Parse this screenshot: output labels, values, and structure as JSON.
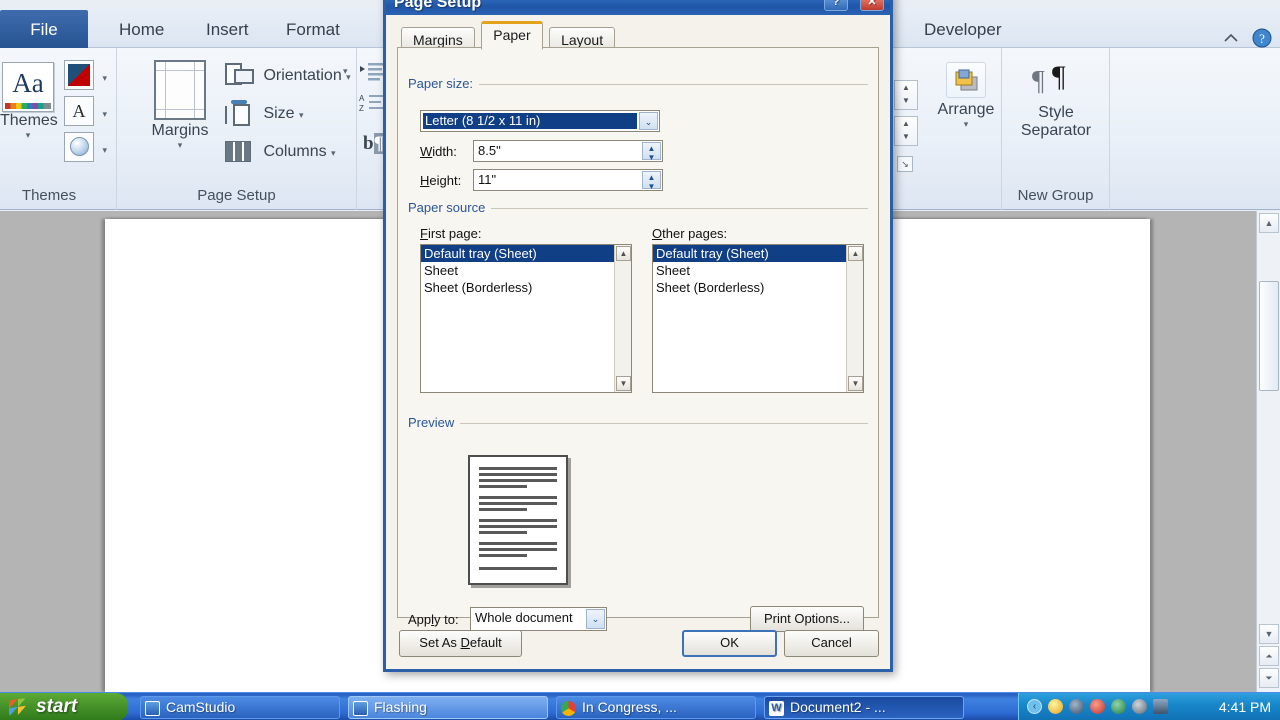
{
  "word": {
    "tabs": [
      {
        "label": "File",
        "kind": "file"
      },
      {
        "label": "Home",
        "kind": "normal"
      },
      {
        "label": "Insert",
        "kind": "normal"
      },
      {
        "label": "Format",
        "kind": "normal"
      },
      {
        "label": "Developer",
        "kind": "normal"
      }
    ],
    "groups": {
      "themes": {
        "name": "Themes",
        "big_button": "Themes",
        "aa_glyph": "Aa",
        "font_glyph": "A"
      },
      "page_setup": {
        "name": "Page Setup",
        "margins": "Margins",
        "orientation": "Orientation",
        "size": "Size",
        "columns": "Columns"
      },
      "arrange": {
        "name": "",
        "label": "Arrange"
      },
      "new_group": {
        "name": "New Group",
        "style_separator_line1": "Style",
        "style_separator_line2": "Separator"
      }
    },
    "caret": "▾",
    "help_icon": "help-icon",
    "collapse_icon": "collapse-ribbon-icon"
  },
  "dialog": {
    "title": "Page Setup",
    "help_button": "?",
    "close_button": "✕",
    "tabs": [
      {
        "label": "Margins",
        "active": false
      },
      {
        "label": "Paper",
        "active": true
      },
      {
        "label": "Layout",
        "active": false
      }
    ],
    "paper_size": {
      "section_title": "Paper size:",
      "selected": "Letter (8 1/2 x 11 in)",
      "width_label": "Width:",
      "width_value": "8.5\"",
      "height_label": "Height:",
      "height_value": "11\""
    },
    "paper_source": {
      "section_title": "Paper source",
      "first_page_label": "First page:",
      "other_pages_label": "Other pages:",
      "first_page_items": [
        "Default tray (Sheet)",
        "Sheet",
        "Sheet (Borderless)"
      ],
      "first_page_selected_index": 0,
      "other_pages_items": [
        "Default tray (Sheet)",
        "Sheet",
        "Sheet (Borderless)"
      ],
      "other_pages_selected_index": 0
    },
    "preview": {
      "section_title": "Preview",
      "apply_to_label": "Apply to:",
      "apply_to_value": "Whole document",
      "print_options_button": "Print Options..."
    },
    "buttons": {
      "set_as_default": "Set As Default",
      "ok": "OK",
      "cancel": "Cancel"
    },
    "arrows": {
      "down": "▼",
      "up": "▲",
      "chevron_down": "⌄"
    }
  },
  "taskbar": {
    "start_label": "start",
    "items": [
      {
        "label": "CamStudio",
        "state": "normal",
        "icon": "camstudio-icon"
      },
      {
        "label": "Flashing",
        "state": "flash",
        "icon": "camstudio-icon"
      },
      {
        "label": "In Congress, ...",
        "state": "normal",
        "icon": "chrome-icon"
      },
      {
        "label": "Document2 - ...",
        "state": "active",
        "icon": "word-icon"
      }
    ],
    "clock": "4:41 PM",
    "tray_icons": [
      "show-hidden-icons-chevron",
      "network-icon",
      "volume-icon",
      "antivirus-icon",
      "globe-icon",
      "plug-icon",
      "display-icon"
    ]
  },
  "colors": {
    "title_bar_blue": "#1f56a8",
    "accent_orange": "#e3a21a",
    "selection_blue": "#103f86",
    "taskbar_blue": "#2d6ad2",
    "start_green": "#47932a"
  }
}
